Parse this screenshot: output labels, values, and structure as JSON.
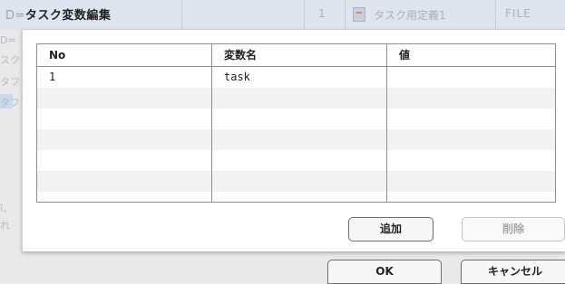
{
  "background": {
    "title_prefix": "D=",
    "title": "タスク変数編集",
    "row_number": "1",
    "task_definition": "タスク用定義1",
    "file_type": "FILE",
    "left_fragments": [
      "D=",
      "スク",
      "タフ",
      "タフ",
      "ī、",
      "れ"
    ]
  },
  "dialog": {
    "grid": {
      "columns": [
        "No",
        "変数名",
        "値"
      ],
      "rows": [
        [
          "1",
          "task",
          ""
        ],
        [
          "",
          "",
          ""
        ],
        [
          "",
          "",
          ""
        ],
        [
          "",
          "",
          ""
        ],
        [
          "",
          "",
          ""
        ],
        [
          "",
          "",
          ""
        ],
        [
          "",
          "",
          ""
        ]
      ]
    },
    "buttons": {
      "add": "追加",
      "delete": "削除"
    }
  },
  "footer": {
    "ok": "OK",
    "cancel": "キャンセル"
  }
}
